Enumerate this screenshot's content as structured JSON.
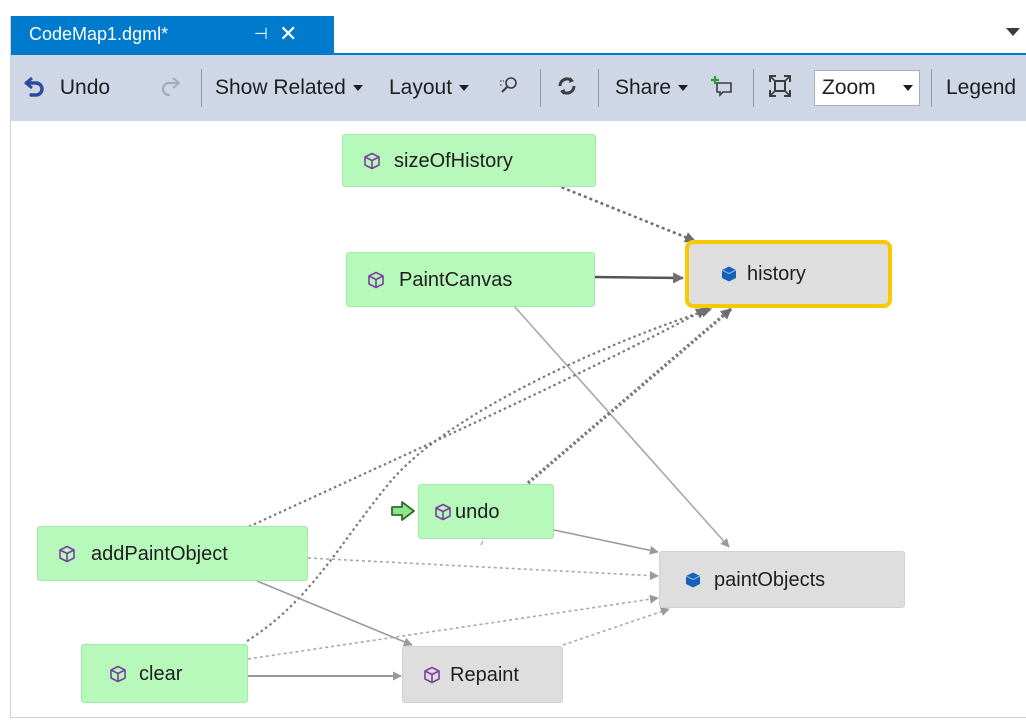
{
  "tab": {
    "title": "CodeMap1.dgml*",
    "pin_glyph": "⊣",
    "close_glyph": "✕"
  },
  "toolbar": {
    "undo_label": "Undo",
    "show_related_label": "Show Related",
    "layout_label": "Layout",
    "share_label": "Share",
    "zoom_value": "Zoom",
    "legend_label": "Legend"
  },
  "graph": {
    "nodes": {
      "sizeOfHistory": "sizeOfHistory",
      "history": "history",
      "PaintCanvas": "PaintCanvas",
      "undo": "undo",
      "addPaintObject": "addPaintObject",
      "paintObjects": "paintObjects",
      "clear": "clear",
      "Repaint": "Repaint"
    },
    "node_types": {
      "method_icon": "method-cube-icon",
      "field_icon": "field-cube-icon"
    },
    "selected_node": "history",
    "entry_point_node": "undo"
  },
  "colors": {
    "tab_accent": "#007acc",
    "toolbar_bg": "#cfd6e5",
    "method_node": "#b7f8bb",
    "field_node": "#dedede",
    "selection": "#f8c900",
    "method_icon": "#7b3fa0",
    "field_icon": "#1560b8"
  }
}
